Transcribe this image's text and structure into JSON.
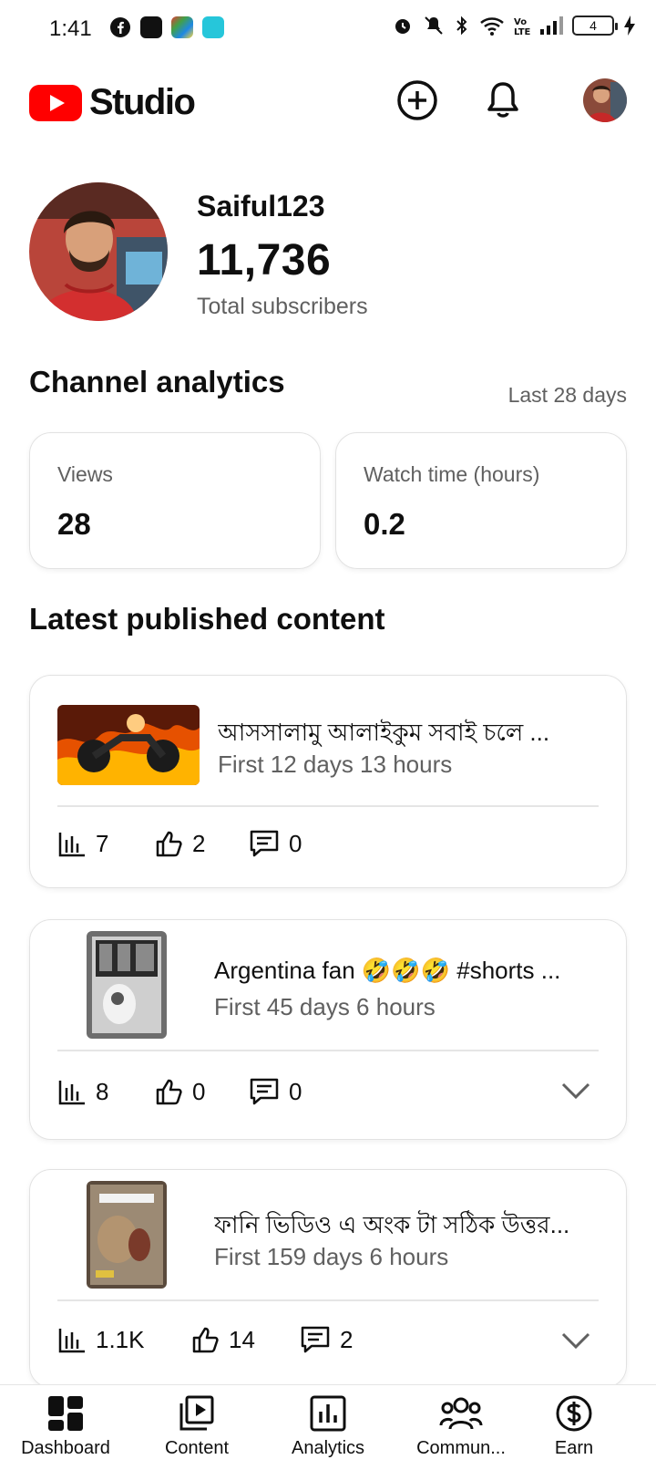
{
  "status_bar": {
    "time": "1:41",
    "battery": "4"
  },
  "app": {
    "logo_text": "Studio"
  },
  "channel": {
    "name": "Saiful123",
    "subscribers": "11,736",
    "subscribers_label": "Total subscribers"
  },
  "analytics": {
    "title": "Channel analytics",
    "period": "Last 28 days",
    "metrics": [
      {
        "label": "Views",
        "value": "28"
      },
      {
        "label": "Watch time (hours)",
        "value": "0.2"
      }
    ]
  },
  "latest": {
    "title": "Latest published content",
    "items": [
      {
        "title": "আসসালামু আলাইকুম সবাই চলে ...",
        "subtitle": "First 12 days 13 hours",
        "views": "7",
        "likes": "2",
        "comments": "0",
        "thumb_icon": "fire-motorcycle-thumbnail"
      },
      {
        "title": "Argentina fan 🤣🤣🤣 #shorts ...",
        "subtitle": "First 45 days 6 hours",
        "views": "8",
        "likes": "0",
        "comments": "0",
        "thumb_icon": "short-video-thumbnail"
      },
      {
        "title": "ফানি ভিডিও এ অংক টা সঠিক উত্তর...",
        "subtitle": "First 159 days 6 hours",
        "views": "1.1K",
        "likes": "14",
        "comments": "2",
        "thumb_icon": "short-video-thumbnail"
      }
    ]
  },
  "nav": {
    "items": [
      {
        "label": "Dashboard",
        "icon": "dashboard-icon"
      },
      {
        "label": "Content",
        "icon": "content-icon"
      },
      {
        "label": "Analytics",
        "icon": "analytics-icon"
      },
      {
        "label": "Commun...",
        "icon": "community-icon"
      },
      {
        "label": "Earn",
        "icon": "earn-icon"
      }
    ]
  },
  "colors": {
    "brand": "#ff0000",
    "text": "#0f0f0f",
    "secondary": "#606060"
  }
}
